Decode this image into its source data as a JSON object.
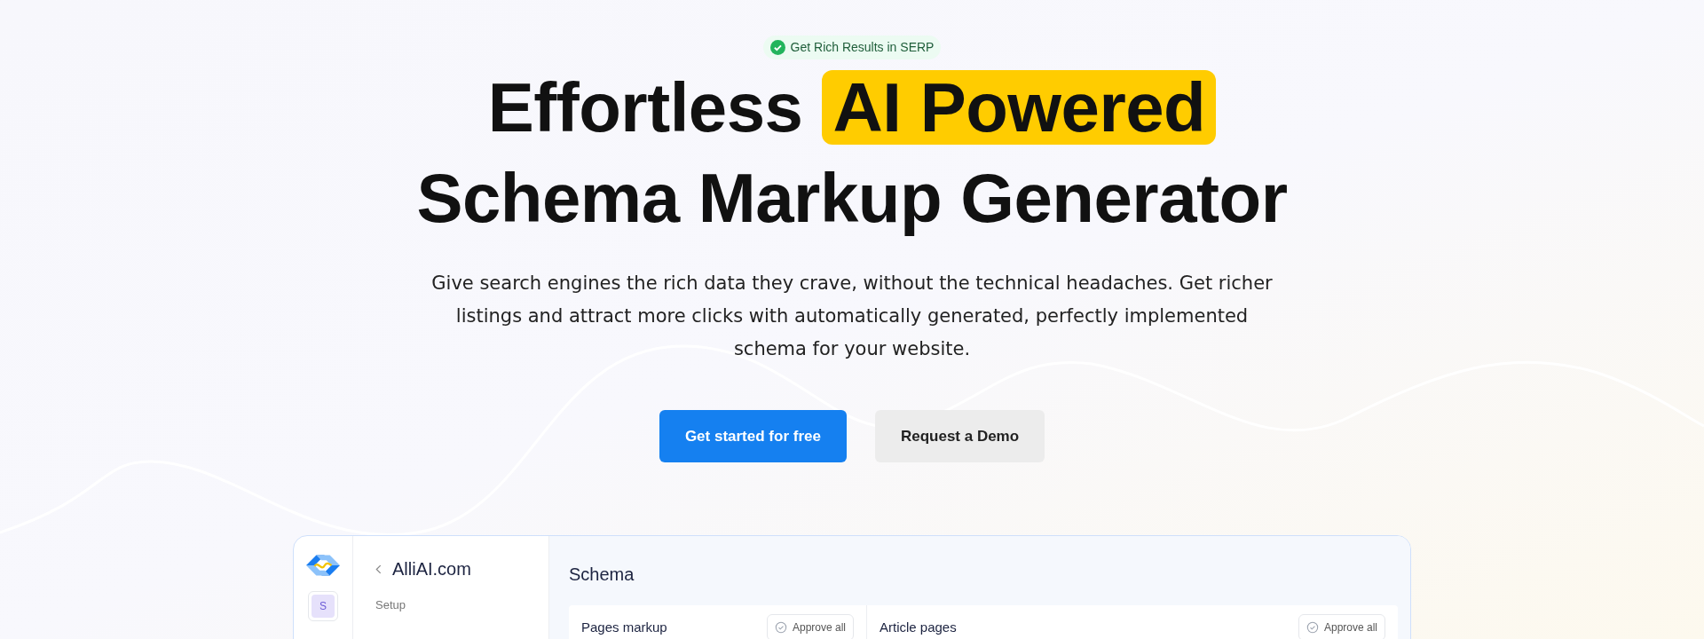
{
  "badge": {
    "label": "Get Rich Results in SERP"
  },
  "hero": {
    "title_start": "Effortless",
    "title_highlight": "AI Powered",
    "title_end": "Schema Markup Generator",
    "description": "Give search engines the rich data they crave, without the technical headaches. Get richer listings and attract more clicks with automatically generated, perfectly implemented schema for your website."
  },
  "buttons": [
    {
      "label": "Get started for free",
      "kind": "primary"
    },
    {
      "label": "Request a Demo",
      "kind": "secondary"
    }
  ],
  "app_preview": {
    "workspace_avatar": "S",
    "site": "AlliAI.com",
    "nav_section": "Setup",
    "page_title": "Schema",
    "cards": [
      {
        "title": "Pages markup",
        "action": "Approve all"
      },
      {
        "title": "Article pages",
        "action": "Approve all"
      }
    ]
  }
}
